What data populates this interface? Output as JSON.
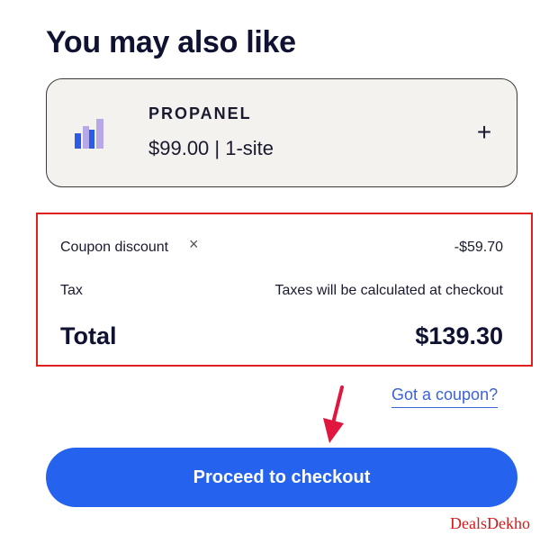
{
  "section_title": "You may also like",
  "product": {
    "name": "PROPANEL",
    "price_line": "$99.00 | 1-site",
    "add_symbol": "+",
    "icon": "bar-chart-logo-icon",
    "colors": {
      "bar_dark": "#2e5be6",
      "bar_light": "#b8a8e8"
    }
  },
  "summary": {
    "coupon_label": "Coupon discount",
    "coupon_remove_symbol": "×",
    "coupon_value": "-$59.70",
    "tax_label": "Tax",
    "tax_value": "Taxes will be calculated at checkout",
    "total_label": "Total",
    "total_value": "$139.30"
  },
  "coupon_link": "Got a coupon?",
  "checkout_label": "Proceed to checkout",
  "watermark": "DealsDekho",
  "colors": {
    "accent": "#2563ee",
    "highlight_border": "#e0201c",
    "arrow": "#e0163f",
    "link": "#3b63d4"
  }
}
